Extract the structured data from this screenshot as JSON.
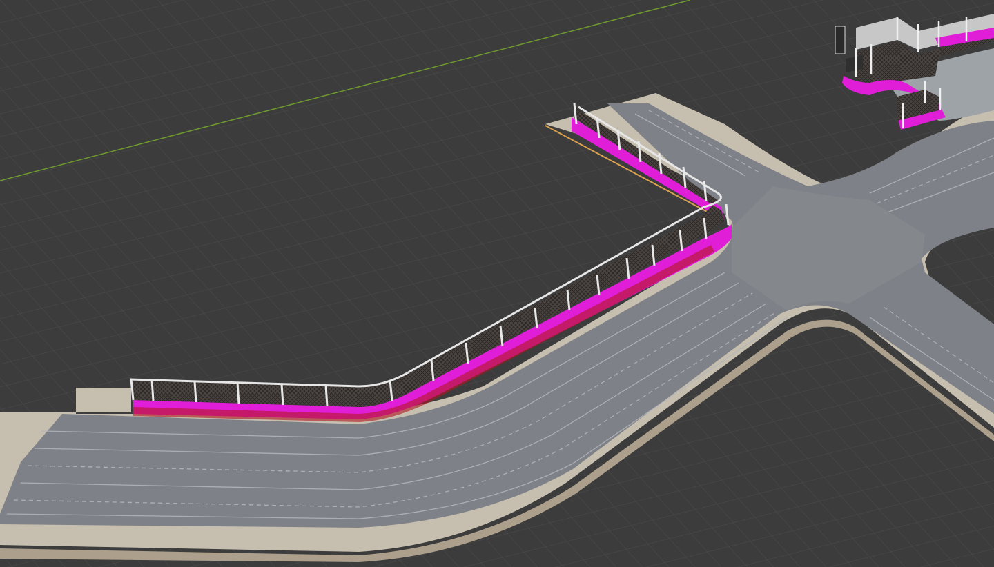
{
  "app": "3D viewport",
  "viewport": {
    "background": "#3c3c3c",
    "grid_color": "#4a4a4a",
    "x_axis_color": "#6f9a2e"
  },
  "scene": {
    "objects": [
      {
        "name": "road",
        "material_color": "#7e8187"
      },
      {
        "name": "sidewalk",
        "material_color": "#c6beae"
      },
      {
        "name": "barrier-fence",
        "material_color": "#e6e6e6"
      },
      {
        "name": "barrier-base",
        "material_color": "#e01ed8"
      },
      {
        "name": "distant-fence-block",
        "material_color": "#c9c9c9"
      }
    ]
  }
}
